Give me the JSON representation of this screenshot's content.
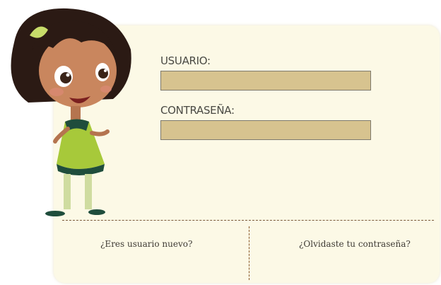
{
  "form": {
    "username_label": "USUARIO:",
    "username_value": "",
    "password_label": "CONTRASEÑA:",
    "password_value": ""
  },
  "links": {
    "new_user": "¿Eres usuario nuevo?",
    "forgot_password": "¿Olvidaste tu contraseña?"
  },
  "colors": {
    "panel": "#fcf9e6",
    "field": "#d7c38f",
    "field_border": "#7e7a6e",
    "divider": "#7a5a3a"
  }
}
